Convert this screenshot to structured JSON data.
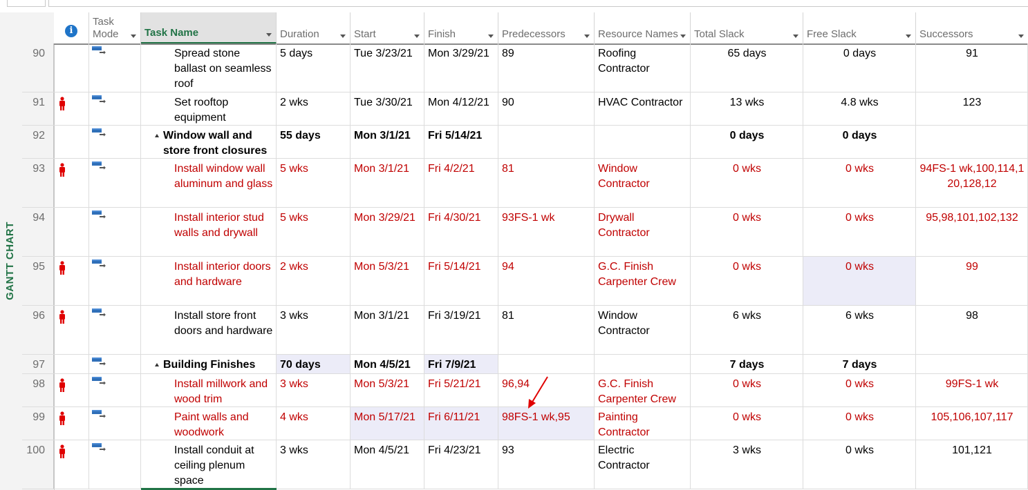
{
  "view_bar": {
    "label": "GANTT CHART"
  },
  "header": {
    "columns": [
      {
        "key": "info",
        "label": ""
      },
      {
        "key": "mode",
        "label": "Task Mode"
      },
      {
        "key": "name",
        "label": "Task Name"
      },
      {
        "key": "duration",
        "label": "Duration"
      },
      {
        "key": "start",
        "label": "Start"
      },
      {
        "key": "finish",
        "label": "Finish"
      },
      {
        "key": "pred",
        "label": "Predecessors"
      },
      {
        "key": "res",
        "label": "Resource Names"
      },
      {
        "key": "total",
        "label": "Total Slack"
      },
      {
        "key": "free",
        "label": "Free Slack"
      },
      {
        "key": "succ",
        "label": "Successors"
      }
    ],
    "info_icon": "i"
  },
  "rows": [
    {
      "id": "90",
      "name": "Spread stone ballast on seamless roof",
      "duration": "5 days",
      "start": "Tue 3/23/21",
      "finish": "Mon 3/29/21",
      "pred": "89",
      "res": "Roofing Contractor",
      "total": "65 days",
      "free": "0 days",
      "succ": "91",
      "critical": false,
      "summary": false,
      "indicator": false
    },
    {
      "id": "91",
      "name": "Set rooftop equipment",
      "duration": "2 wks",
      "start": "Tue 3/30/21",
      "finish": "Mon 4/12/21",
      "pred": "90",
      "res": "HVAC Contractor",
      "total": "13 wks",
      "free": "4.8 wks",
      "succ": "123",
      "critical": false,
      "summary": false,
      "indicator": true
    },
    {
      "id": "92",
      "name": "Window wall and store front closures",
      "duration": "55 days",
      "start": "Mon 3/1/21",
      "finish": "Fri 5/14/21",
      "pred": "",
      "res": "",
      "total": "0 days",
      "free": "0 days",
      "succ": "",
      "critical": false,
      "summary": true,
      "indicator": false
    },
    {
      "id": "93",
      "name": "Install window wall aluminum and glass",
      "duration": "5 wks",
      "start": "Mon 3/1/21",
      "finish": "Fri 4/2/21",
      "pred": "81",
      "res": "Window Contractor",
      "total": "0 wks",
      "free": "0 wks",
      "succ": "94FS-1 wk,100,114,120,128,12",
      "critical": true,
      "summary": false,
      "indicator": true
    },
    {
      "id": "94",
      "name": "Install interior stud walls and drywall",
      "duration": "5 wks",
      "start": "Mon 3/29/21",
      "finish": "Fri 4/30/21",
      "pred": "93FS-1 wk",
      "res": "Drywall Contractor",
      "total": "0 wks",
      "free": "0 wks",
      "succ": "95,98,101,102,132",
      "critical": true,
      "summary": false,
      "indicator": false
    },
    {
      "id": "95",
      "name": "Install interior doors and hardware",
      "duration": "2 wks",
      "start": "Mon 5/3/21",
      "finish": "Fri 5/14/21",
      "pred": "94",
      "res": "G.C. Finish Carpenter Crew",
      "total": "0 wks",
      "free": "0 wks",
      "succ": "99",
      "critical": true,
      "summary": false,
      "indicator": true
    },
    {
      "id": "96",
      "name": "Install store front doors and hardware",
      "duration": "3 wks",
      "start": "Mon 3/1/21",
      "finish": "Fri 3/19/21",
      "pred": "81",
      "res": "Window Contractor",
      "total": "6 wks",
      "free": "6 wks",
      "succ": "98",
      "critical": false,
      "summary": false,
      "indicator": true
    },
    {
      "id": "97",
      "name": "Building Finishes",
      "duration": "70 days",
      "start": "Mon 4/5/21",
      "finish": "Fri 7/9/21",
      "pred": "",
      "res": "",
      "total": "7 days",
      "free": "7 days",
      "succ": "",
      "critical": false,
      "summary": true,
      "indicator": false
    },
    {
      "id": "98",
      "name": "Install millwork and wood trim",
      "duration": "3 wks",
      "start": "Mon 5/3/21",
      "finish": "Fri 5/21/21",
      "pred": "96,94",
      "res": "G.C. Finish Carpenter Crew",
      "total": "0 wks",
      "free": "0 wks",
      "succ": "99FS-1 wk",
      "critical": true,
      "summary": false,
      "indicator": true
    },
    {
      "id": "99",
      "name": "Paint walls and woodwork",
      "duration": "4 wks",
      "start": "Mon 5/17/21",
      "finish": "Fri 6/11/21",
      "pred": "98FS-1 wk,95",
      "res": "Painting Contractor",
      "total": "0 wks",
      "free": "0 wks",
      "succ": "105,106,107,117",
      "critical": true,
      "summary": false,
      "indicator": true
    },
    {
      "id": "100",
      "name": "Install conduit at ceiling plenum space",
      "duration": "3 wks",
      "start": "Mon 4/5/21",
      "finish": "Fri 4/23/21",
      "pred": "93",
      "res": "Electric Contractor",
      "total": "3 wks",
      "free": "0 wks",
      "succ": "101,121",
      "critical": false,
      "summary": false,
      "indicator": true
    }
  ],
  "colors": {
    "critical": "#c00000",
    "accent": "#217346",
    "info": "#1f74c8",
    "shade": "#ececf8"
  }
}
